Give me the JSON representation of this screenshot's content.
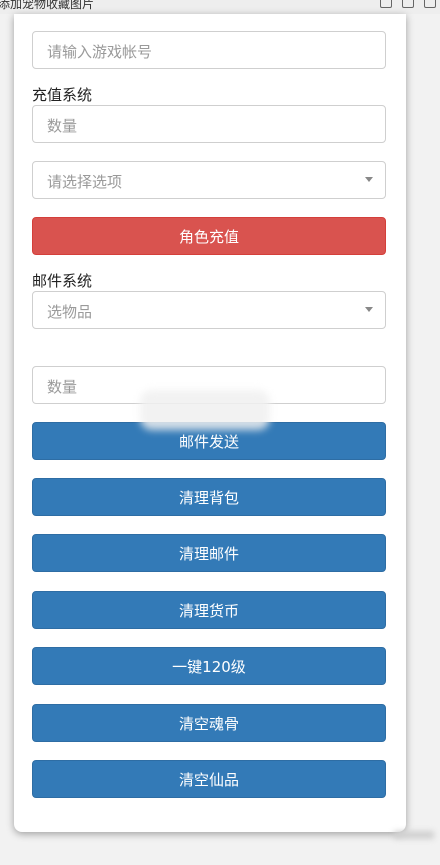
{
  "window": {
    "title": "添加宠物收藏图片"
  },
  "form": {
    "account_placeholder": "请输入游戏帐号",
    "recharge": {
      "section_title": "充值系统",
      "quantity_placeholder": "数量",
      "option_placeholder": "请选择选项",
      "submit_label": "角色充值"
    },
    "mail": {
      "section_title": "邮件系统",
      "item_placeholder": "选物品",
      "quantity_placeholder": "数量",
      "send_label": "邮件发送"
    },
    "actions": [
      "清理背包",
      "清理邮件",
      "清理货币",
      "一键120级",
      "清空魂骨",
      "清空仙品"
    ]
  },
  "colors": {
    "danger": "#d9534f",
    "primary": "#337ab7"
  }
}
